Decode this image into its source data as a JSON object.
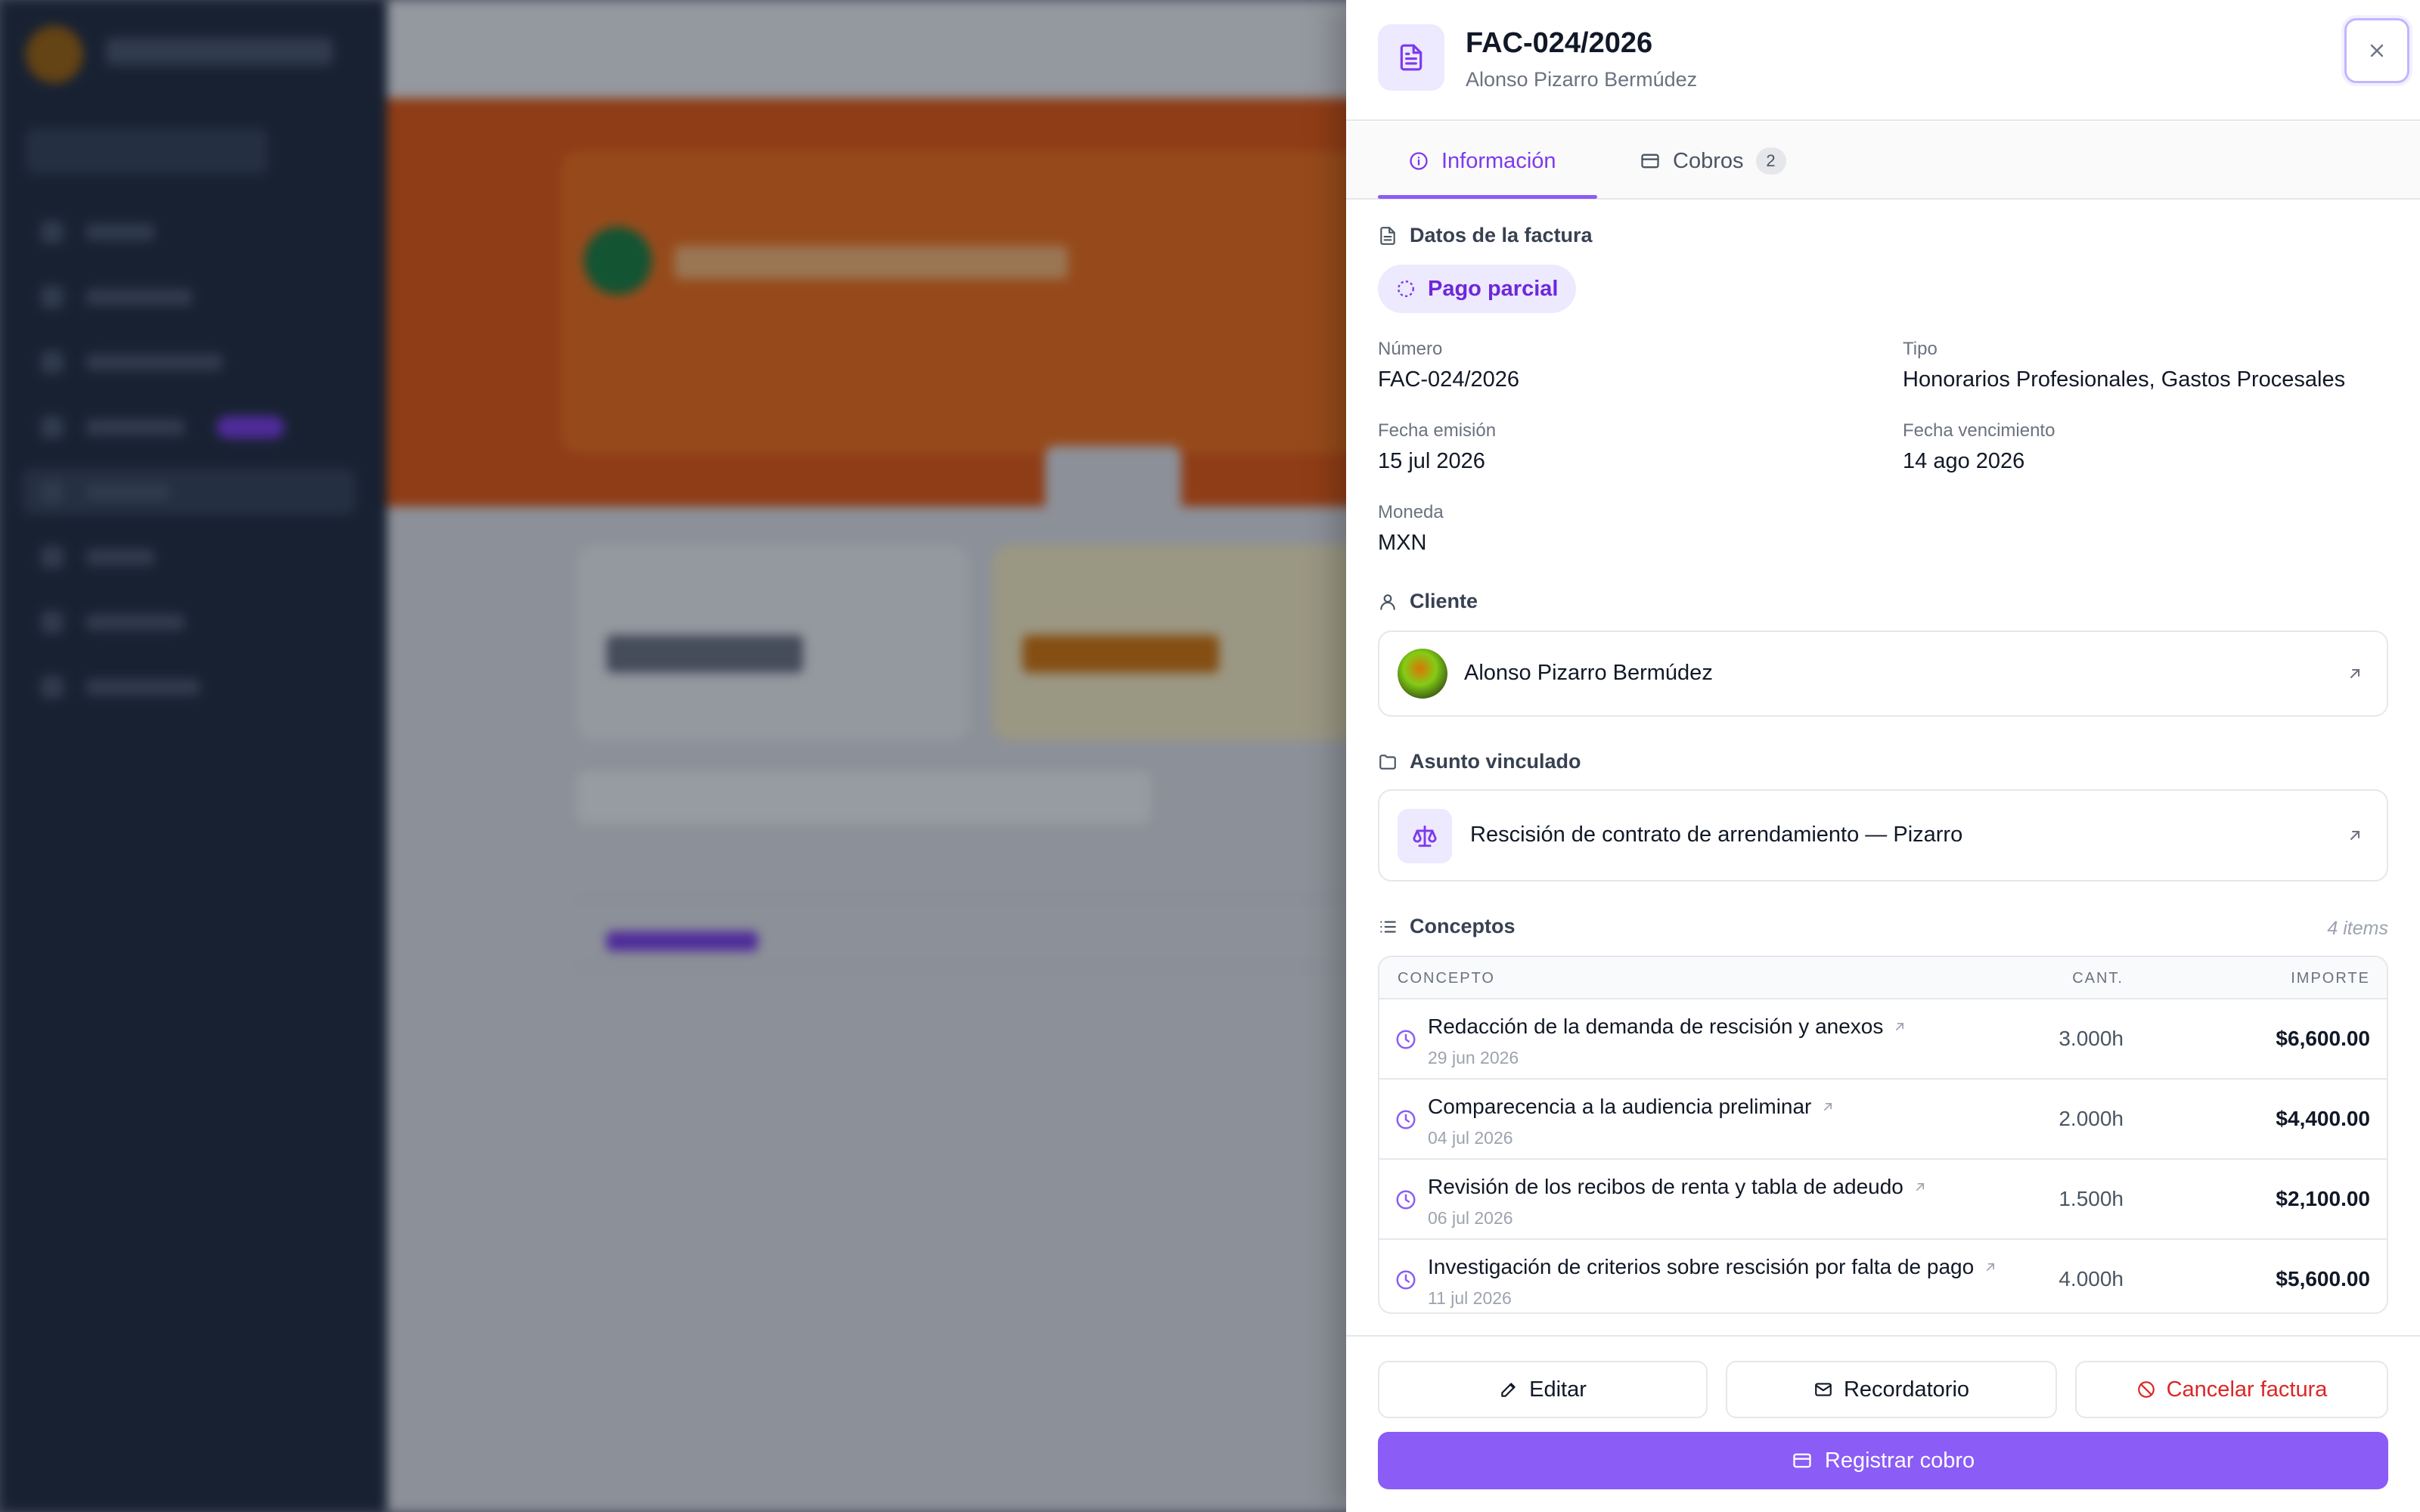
{
  "invoice": {
    "number": "FAC-024/2026",
    "client_name": "Alonso Pizarro Bermúdez"
  },
  "tabs": [
    {
      "label": "Información",
      "icon": "info-icon",
      "active": true
    },
    {
      "label": "Cobros",
      "icon": "card-icon",
      "count": "2"
    }
  ],
  "details": {
    "section_title": "Datos de la factura",
    "status": "Pago parcial",
    "fields": {
      "numero": {
        "label": "Número",
        "value": "FAC-024/2026"
      },
      "tipo": {
        "label": "Tipo",
        "value": "Honorarios Profesionales, Gastos Procesales"
      },
      "fecha_emision": {
        "label": "Fecha emisión",
        "value": "15 jul 2026"
      },
      "fecha_vencimiento": {
        "label": "Fecha vencimiento",
        "value": "14 ago 2026"
      },
      "moneda": {
        "label": "Moneda",
        "value": "MXN"
      }
    }
  },
  "client": {
    "section_title": "Cliente",
    "name": "Alonso Pizarro Bermúdez"
  },
  "matter": {
    "section_title": "Asunto vinculado",
    "name": "Rescisión de contrato de arrendamiento — Pizarro"
  },
  "concepts": {
    "section_title": "Conceptos",
    "count_label": "4 items",
    "headers": {
      "concept": "CONCEPTO",
      "qty": "CANT.",
      "amount": "IMPORTE"
    },
    "rows": [
      {
        "description": "Redacción de la demanda de rescisión y anexos",
        "date": "29 jun 2026",
        "qty": "3.000h",
        "amount": "$6,600.00"
      },
      {
        "description": "Comparecencia a la audiencia preliminar",
        "date": "04 jul 2026",
        "qty": "2.000h",
        "amount": "$4,400.00"
      },
      {
        "description": "Revisión de los recibos de renta y tabla de adeudo",
        "date": "06 jul 2026",
        "qty": "1.500h",
        "amount": "$2,100.00"
      },
      {
        "description": "Investigación de criterios sobre rescisión por falta de pago",
        "date": "11 jul 2026",
        "qty": "4.000h",
        "amount": "$5,600.00"
      }
    ]
  },
  "actions": {
    "edit": "Editar",
    "reminder": "Recordatorio",
    "cancel": "Cancelar factura",
    "register_payment": "Registrar cobro"
  },
  "colors": {
    "accent": "#8b5cf6",
    "accent_text": "#7c3aed",
    "danger": "#dc2626",
    "status_bg": "#ede9fe"
  }
}
